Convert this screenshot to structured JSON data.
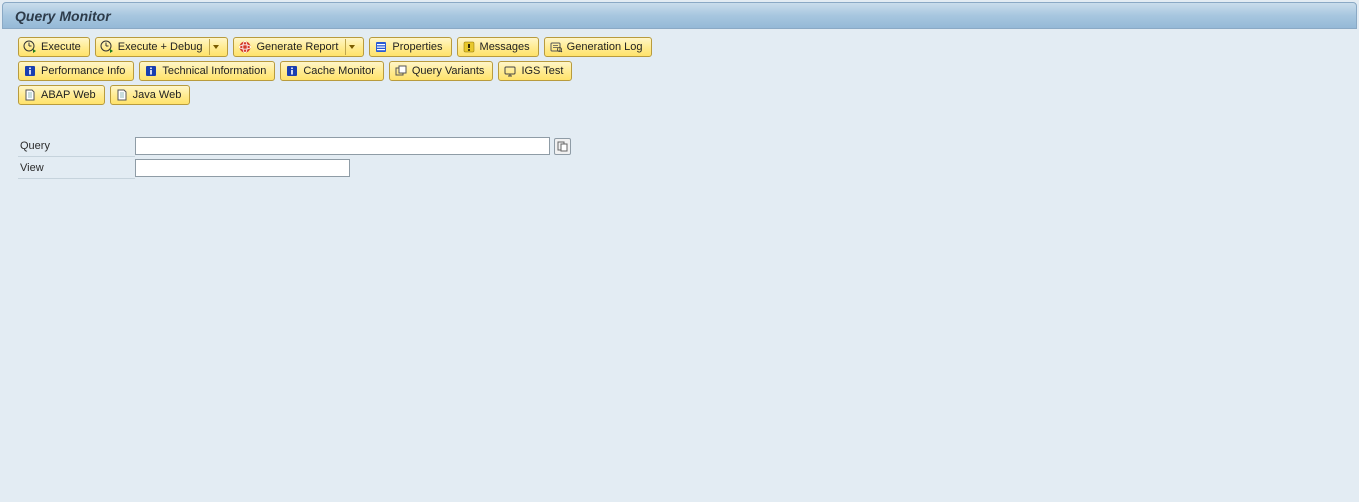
{
  "title": "Query Monitor",
  "toolbar": {
    "row1": [
      {
        "id": "execute",
        "label": "Execute",
        "icon": "clock-run",
        "dropdown": false
      },
      {
        "id": "execute-debug",
        "label": "Execute + Debug",
        "icon": "clock-run",
        "dropdown": true
      },
      {
        "id": "generate-report",
        "label": "Generate Report",
        "icon": "globe-red",
        "dropdown": true
      },
      {
        "id": "properties",
        "label": "Properties",
        "icon": "props-blue",
        "dropdown": false
      },
      {
        "id": "messages",
        "label": "Messages",
        "icon": "warn-yellow",
        "dropdown": false
      },
      {
        "id": "generation-log",
        "label": "Generation Log",
        "icon": "log",
        "dropdown": false
      }
    ],
    "row2": [
      {
        "id": "performance-info",
        "label": "Performance Info",
        "icon": "info-blue"
      },
      {
        "id": "technical-information",
        "label": "Technical Information",
        "icon": "info-blue"
      },
      {
        "id": "cache-monitor",
        "label": "Cache Monitor",
        "icon": "info-blue"
      },
      {
        "id": "query-variants",
        "label": "Query Variants",
        "icon": "variants"
      },
      {
        "id": "igs-test",
        "label": "IGS Test",
        "icon": "screen"
      }
    ],
    "row3": [
      {
        "id": "abap-web",
        "label": "ABAP Web",
        "icon": "doc"
      },
      {
        "id": "java-web",
        "label": "Java Web",
        "icon": "doc"
      }
    ]
  },
  "form": {
    "query_label": "Query",
    "query_value": "",
    "view_label": "View",
    "view_value": ""
  }
}
